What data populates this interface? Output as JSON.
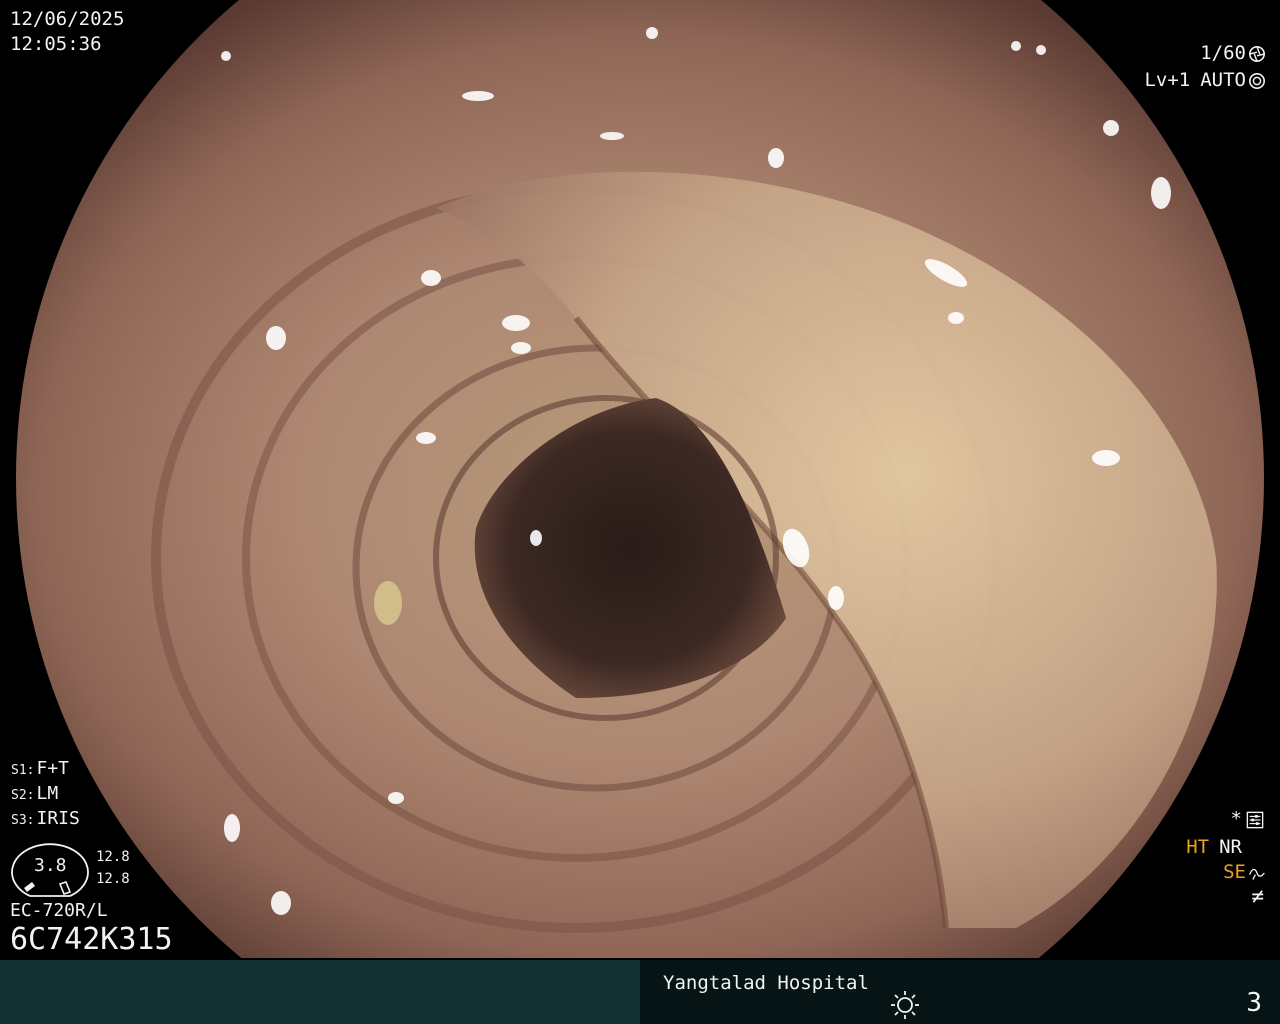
{
  "header": {
    "date": "12/06/2025",
    "time": "12:05:36"
  },
  "exposure": {
    "shutter": "1/60",
    "shutter_icon": "shutter-icon",
    "level": "Lv+1",
    "iris_mode": "AUTO",
    "iris_icon": "iris-icon"
  },
  "settings": [
    {
      "key": "S1:",
      "value": "F+T"
    },
    {
      "key": "S2:",
      "value": "LM"
    },
    {
      "key": "S3:",
      "value": "IRIS"
    }
  ],
  "zoom": {
    "value": "3.8",
    "a": "12.8",
    "b": "12.8"
  },
  "scope": {
    "model": "EC-720R/L",
    "serial": "6C742K315"
  },
  "indicators": {
    "star": "*",
    "star_icon": "settings-sliders-icon",
    "ht": "HT",
    "nr": "NR",
    "se": "SE",
    "se_icon": "wave-icon",
    "filter": "≠"
  },
  "footer": {
    "hospital": "Yangtalad Hospital",
    "brightness_icon": "sun-icon",
    "image_count": "3"
  },
  "colors": {
    "amber": "#f0a020",
    "bar_left": "#123232",
    "bar_right": "#061416"
  }
}
